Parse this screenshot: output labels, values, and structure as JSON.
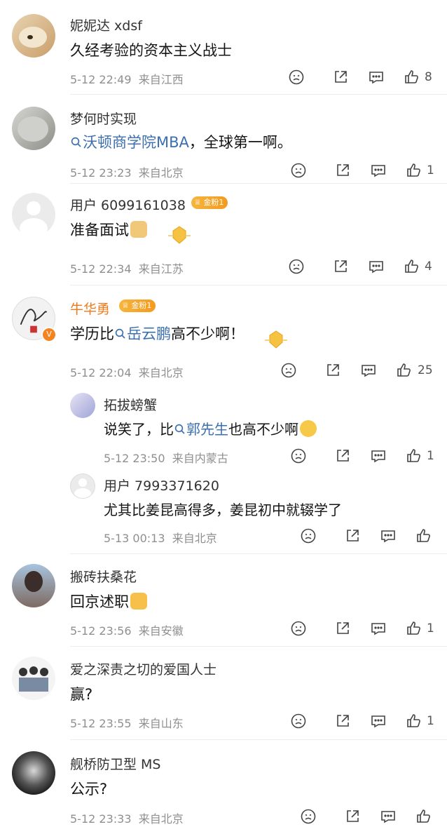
{
  "comments": [
    {
      "user": "妮妮达 xdsf",
      "text": "久经考验的资本主义战士",
      "time": "5-12 22:49",
      "loc": "来自江西",
      "likes": "8"
    },
    {
      "user": "梦何时实现",
      "link": "沃顿商学院MBA",
      "text_after": "，全球第一啊。",
      "time": "5-12 23:23",
      "loc": "来自北京",
      "likes": "1"
    },
    {
      "user": "用户 6099161038",
      "badge": "金粉1",
      "text": "准备面试",
      "time": "5-12 22:34",
      "loc": "来自江苏",
      "likes": "4"
    },
    {
      "user": "牛华勇",
      "badge": "金粉1",
      "text_before": "学历比",
      "link": "岳云鹏",
      "text_after": "高不少啊！",
      "time": "5-12 22:04",
      "loc": "来自北京",
      "likes": "25"
    },
    {
      "user": "搬砖扶桑花",
      "text": "回京述职",
      "time": "5-12 23:56",
      "loc": "来自安徽",
      "likes": "1"
    },
    {
      "user": "爱之深责之切的爱国人士",
      "text": "赢?",
      "time": "5-12 23:55",
      "loc": "来自山东",
      "likes": "1"
    },
    {
      "user": "舰桥防卫型 MS",
      "text": "公示?",
      "time": "5-12 23:33",
      "loc": "来自北京",
      "likes": ""
    }
  ],
  "replies": [
    {
      "user": "拓拔螃蟹",
      "text_before": "说笑了，比",
      "link": "郭先生",
      "text_after": "也高不少啊",
      "time": "5-12 23:50",
      "loc": "来自内蒙古",
      "likes": "1"
    },
    {
      "user": "用户 7993371620",
      "text": "尤其比姜昆高得多，姜昆初中就辍学了",
      "time": "5-13 00:13",
      "loc": "来自北京",
      "likes": ""
    }
  ],
  "icons": {
    "search": "search-icon",
    "dislike": "dislike-icon",
    "share": "share-icon",
    "comment": "comment-icon",
    "like": "like-icon"
  },
  "colors": {
    "link": "#3b6fb0",
    "orange_name": "#f07a18",
    "meta": "#8f8f8f"
  }
}
